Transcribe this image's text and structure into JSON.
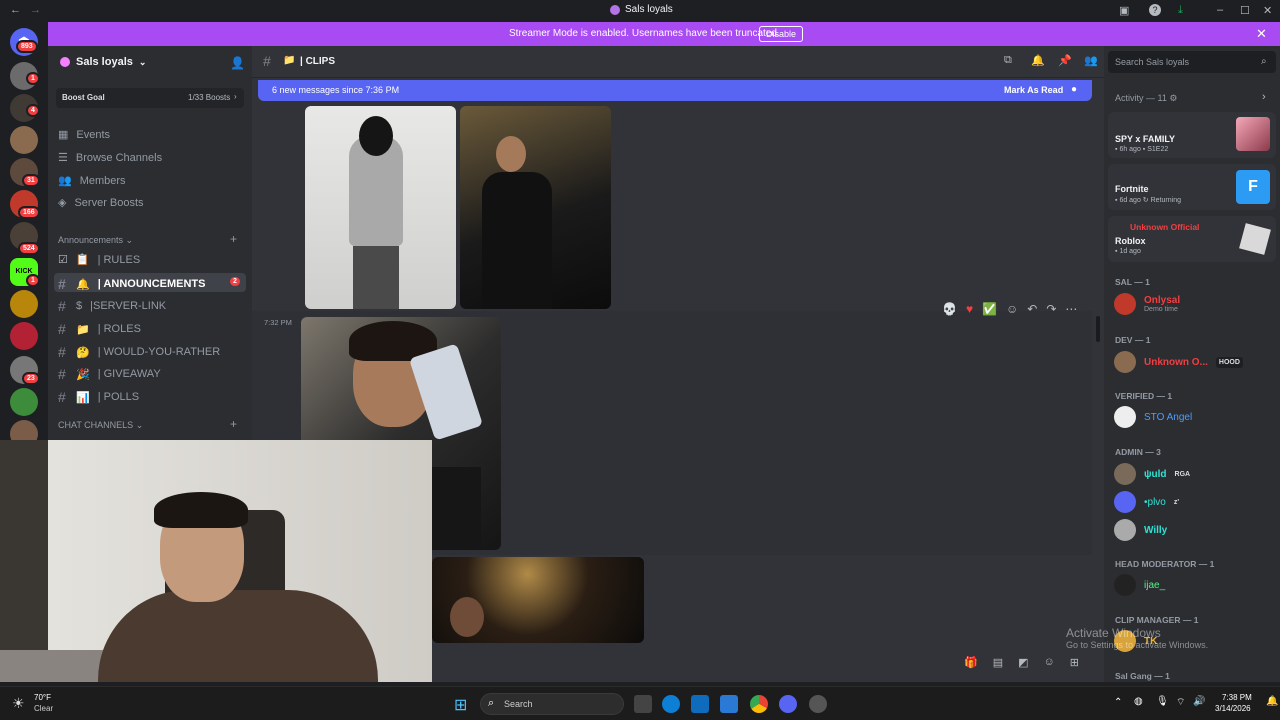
{
  "window": {
    "title": "Sals loyals"
  },
  "banner": {
    "text": "Streamer Mode is enabled. Usernames have been truncated.",
    "button": "Disable"
  },
  "rail": {
    "badges": [
      "893",
      "1",
      "4",
      "31",
      "166",
      "524",
      "1",
      "23"
    ]
  },
  "server": {
    "name": "Sals loyals",
    "boost_goal": "Boost Goal",
    "boost_count": "1/33 Boosts",
    "nav": [
      "Events",
      "Browse Channels",
      "Members",
      "Server Boosts"
    ],
    "categories": {
      "announcements": "Announcements",
      "chat": "CHAT CHANNELS"
    },
    "channels": [
      {
        "label": "| RULES",
        "emoji": "📋",
        "active": false
      },
      {
        "label": "| ANNOUNCEMENTS",
        "emoji": "🔔",
        "active": true,
        "mentions": "2"
      },
      {
        "label": "|SERVER-LINK",
        "emoji": "$",
        "active": false
      },
      {
        "label": "| ROLES",
        "emoji": "📁",
        "active": false
      },
      {
        "label": "| WOULD-YOU-RATHER",
        "emoji": "🤔",
        "active": false
      },
      {
        "label": "| GIVEAWAY",
        "emoji": "🎉",
        "active": false
      },
      {
        "label": "| POLLS",
        "emoji": "📊",
        "active": false
      }
    ]
  },
  "channel": {
    "name": "| CLIPS",
    "search_placeholder": "Search Sals loyals",
    "new_messages": "6 new messages since 7:36 PM",
    "mark_read": "Mark As Read",
    "timestamp": "7:32 PM"
  },
  "activity": {
    "header": "Activity — 11",
    "items": [
      {
        "title": "SPY x FAMILY",
        "meta": "6h ago",
        "extra": "S1E22"
      },
      {
        "title": "Fortnite",
        "meta": "6d ago",
        "extra": "Returning"
      },
      {
        "title": "Roblox",
        "user": "Unknown Official",
        "meta": "1d ago"
      }
    ]
  },
  "members": {
    "groups": [
      {
        "cat": "SAL — 1",
        "name": "Onlysal",
        "sub": "Demo time",
        "color": "#f23f42"
      },
      {
        "cat": "DEV — 1",
        "name": "Unknown O...",
        "tag": "HOOD",
        "color": "#f23f42"
      },
      {
        "cat": "VERIFIED — 1",
        "name": "STO Angel",
        "color": "#4e9cff"
      },
      {
        "cat": "ADMIN — 3",
        "names": [
          "ψuld",
          "•plvo",
          "Willy"
        ],
        "tags": [
          "RGA",
          "z'"
        ],
        "color": "#2ee3d6"
      },
      {
        "cat": "HEAD MODERATOR — 1",
        "name": "ijae_",
        "color": "#57f287"
      },
      {
        "cat": "CLIP MANAGER — 1",
        "name": "TK"
      },
      {
        "cat": "Sal Gang — 1"
      }
    ]
  },
  "watermark": {
    "line1": "Activate Windows",
    "line2": "Go to Settings to activate Windows."
  },
  "taskbar": {
    "temp": "70°F",
    "weather": "Clear",
    "search": "Search",
    "time": "7:38 PM",
    "date": "3/14/2026"
  },
  "colors": {
    "banner": "#a84bf2",
    "blurple": "#5865f2",
    "mention": "#f23f42"
  }
}
